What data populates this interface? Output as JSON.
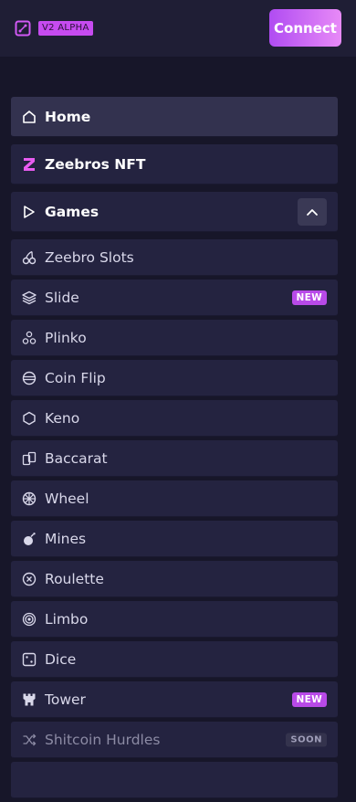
{
  "header": {
    "version_badge": "V2 ALPHA",
    "connect_label": "Connect",
    "logo_icon": "dice-logo-icon"
  },
  "menu": {
    "home": "Home",
    "nft": "Zeebros NFT",
    "games": "Games",
    "items": [
      {
        "label": "Zeebro Slots",
        "icon": "cherries-icon"
      },
      {
        "label": "Slide",
        "icon": "layers-icon",
        "badge": "NEW"
      },
      {
        "label": "Plinko",
        "icon": "plinko-icon"
      },
      {
        "label": "Coin Flip",
        "icon": "coin-icon"
      },
      {
        "label": "Keno",
        "icon": "hexagon-icon"
      },
      {
        "label": "Baccarat",
        "icon": "cards-icon"
      },
      {
        "label": "Wheel",
        "icon": "wheel-icon"
      },
      {
        "label": "Mines",
        "icon": "bomb-icon"
      },
      {
        "label": "Roulette",
        "icon": "roulette-icon"
      },
      {
        "label": "Limbo",
        "icon": "target-icon"
      },
      {
        "label": "Dice",
        "icon": "dice-icon"
      },
      {
        "label": "Tower",
        "icon": "tower-icon",
        "badge": "NEW"
      },
      {
        "label": "Shitcoin Hurdles",
        "icon": "shuffle-icon",
        "badge": "SOON"
      }
    ]
  },
  "colors": {
    "background": "#171629",
    "header": "#1f1e35",
    "item": "#242340",
    "accent": "#b84ae8",
    "nft_icon": "#e85cf0"
  }
}
